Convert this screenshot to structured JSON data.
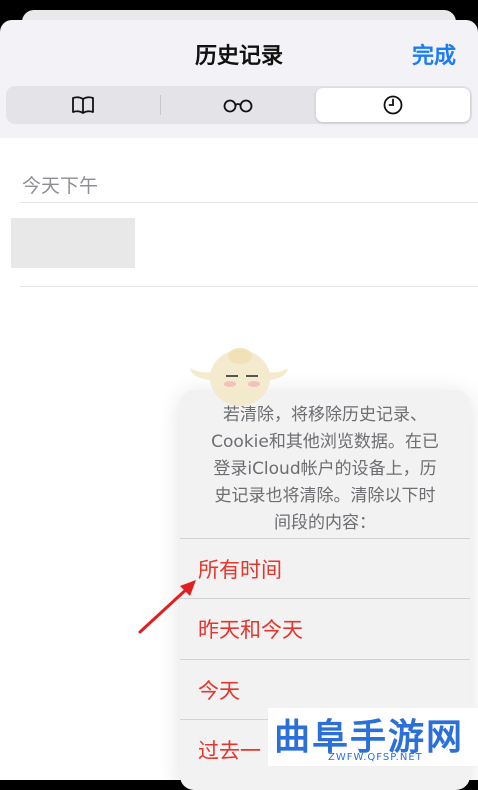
{
  "nav": {
    "title": "历史记录",
    "done": "完成"
  },
  "segments": [
    {
      "icon": "book-icon",
      "active": false
    },
    {
      "icon": "reading-glasses-icon",
      "active": false
    },
    {
      "icon": "clock-icon",
      "active": true
    }
  ],
  "history": {
    "section_header": "今天下午"
  },
  "clear_sheet": {
    "message_lines": [
      "若清除，将移除历史记录、",
      "Cookie和其他浏览数据。在已",
      "登录iCloud帐户的设备上，历",
      "史记录也将清除。清除以下时",
      "间段的内容："
    ],
    "options": [
      "所有时间",
      "昨天和今天",
      "今天",
      "过去一"
    ]
  },
  "watermark": {
    "logo": "曲阜手游网",
    "url": "ZWFW.QFSP.NET"
  },
  "colors": {
    "accent": "#1a7cf7",
    "destructive": "#e5352c",
    "watermark": "#2b6fd8"
  }
}
